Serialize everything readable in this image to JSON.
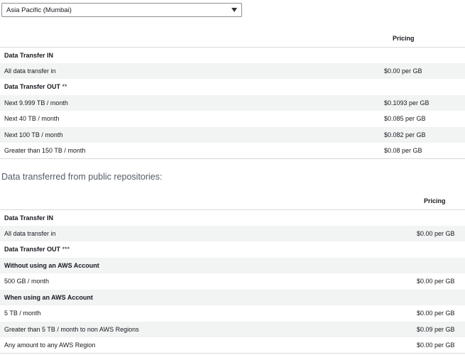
{
  "region_select": {
    "value": "Asia Pacific (Mumbai)"
  },
  "table1": {
    "price_header": "Pricing",
    "rows": [
      {
        "label": "Data Transfer IN",
        "price": "",
        "bold": true
      },
      {
        "label": "All data transfer in",
        "price": "$0.00 per GB",
        "bold": false
      },
      {
        "label": "Data Transfer OUT",
        "suffix": " **",
        "price": "",
        "bold": true
      },
      {
        "label": "Next 9.999 TB / month",
        "price": "$0.1093 per GB",
        "bold": false
      },
      {
        "label": "Next 40 TB / month",
        "price": "$0.085 per GB",
        "bold": false
      },
      {
        "label": "Next 100 TB / month",
        "price": "$0.082 per GB",
        "bold": false
      },
      {
        "label": "Greater than 150 TB / month",
        "price": "$0.08 per GB",
        "bold": false
      }
    ]
  },
  "public_heading": "Data transferred from public repositories:",
  "table2": {
    "price_header": "Pricing",
    "rows": [
      {
        "label": "Data Transfer IN",
        "price": "",
        "bold": true
      },
      {
        "label": "All data transfer in",
        "price": "$0.00 per GB",
        "bold": false
      },
      {
        "label": "Data Transfer OUT",
        "suffix": " ***",
        "price": "",
        "bold": true
      },
      {
        "label": "Without using an AWS Account",
        "price": "",
        "bold": true
      },
      {
        "label": "500 GB / month",
        "price": "$0.00 per GB",
        "bold": false
      },
      {
        "label": "When using an AWS Account",
        "price": "",
        "bold": true
      },
      {
        "label": "5 TB / month",
        "price": "$0.00 per GB",
        "bold": false
      },
      {
        "label": "Greater than 5 TB / month to non AWS Regions",
        "price": "$0.09 per GB",
        "bold": false
      },
      {
        "label": "Any amount to any AWS Region",
        "price": "$0.00 per GB",
        "bold": false
      }
    ]
  }
}
